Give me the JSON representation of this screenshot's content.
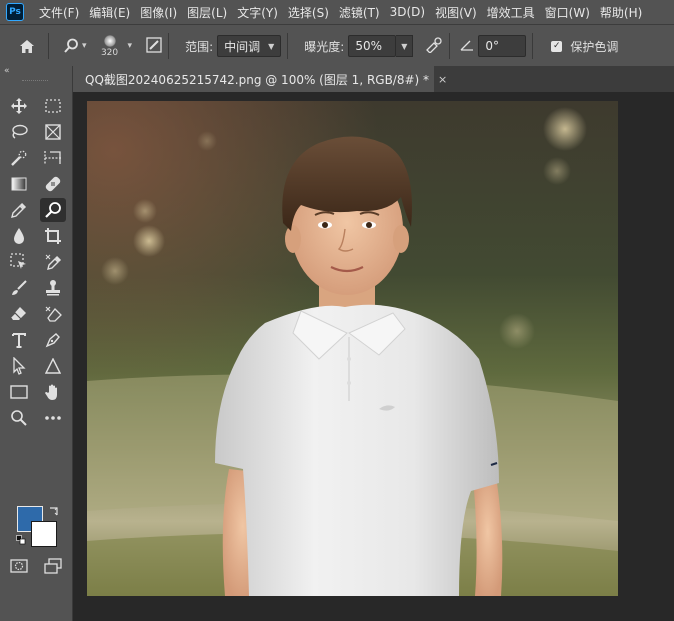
{
  "app": {
    "logo_text": "Ps"
  },
  "menu": [
    "文件(F)",
    "编辑(E)",
    "图像(I)",
    "图层(L)",
    "文字(Y)",
    "选择(S)",
    "滤镜(T)",
    "3D(D)",
    "视图(V)",
    "增效工具",
    "窗口(W)",
    "帮助(H)"
  ],
  "options": {
    "brush_size": "320",
    "range_label": "范围:",
    "range_value": "中间调",
    "exposure_label": "曝光度:",
    "exposure_value": "50%",
    "angle_value": "0°",
    "protect_tones_label": "保护色调",
    "protect_tones_checked": true
  },
  "document": {
    "tab_title": "QQ截图20240625215742.png @ 100% (图层 1, RGB/8#) *",
    "close_glyph": "×"
  },
  "colors": {
    "foreground": "#2e6aaa",
    "background": "#ffffff",
    "ui_panel": "#535353",
    "ui_dark": "#282828"
  },
  "toolbar": {
    "collapse_glyph": "«",
    "tools": [
      "move-tool",
      "marquee-tool",
      "lasso-tool",
      "frame-tool",
      "quick-selection-tool",
      "slice-tool",
      "gradient-tool",
      "healing-brush-tool",
      "eyedropper-tool",
      "dodge-tool",
      "blur-tool",
      "crop-tool",
      "select-subject-tool",
      "color-sampler-tool",
      "brush-tool",
      "clone-stamp-tool",
      "eraser-tool",
      "magic-eraser-tool",
      "type-tool",
      "pen-tool",
      "path-selection-tool",
      "shape-tool",
      "rectangle-tool",
      "hand-tool",
      "zoom-tool",
      "more-tools",
      "quick-mask-mode",
      "screen-mode"
    ]
  }
}
